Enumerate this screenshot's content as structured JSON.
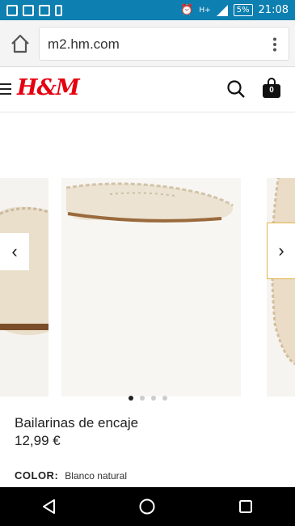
{
  "status_bar": {
    "time": "21:08",
    "battery": "5%",
    "network": "H+"
  },
  "browser": {
    "url": "m2.hm.com"
  },
  "header": {
    "logo": "H&M",
    "bag_count": "0"
  },
  "product": {
    "name": "Bailarinas de encaje",
    "price": "12,99 €",
    "color_label": "COLOR:",
    "color_value": "Blanco natural"
  },
  "carousel": {
    "slide_count": 4,
    "active_index": 0
  }
}
